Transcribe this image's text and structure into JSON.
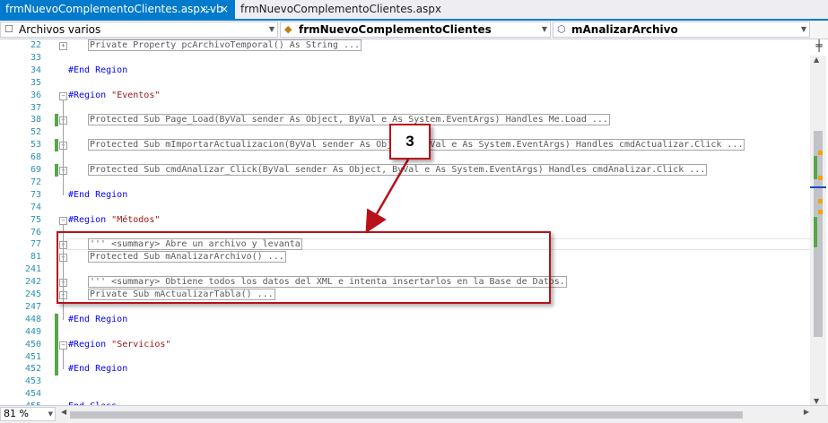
{
  "tabs": [
    {
      "label": "frmNuevoComplementoClientes.aspx.vb",
      "pin": "⊹",
      "close": "×"
    },
    {
      "label": "frmNuevoComplementoClientes.aspx"
    }
  ],
  "nav": {
    "project": "Archivos varios",
    "class": "frmNuevoComplementoClientes",
    "member": "mAnalizarArchivo"
  },
  "zoom": "81 %",
  "annotation": {
    "number": "3"
  },
  "lines": [
    {
      "n": "22",
      "fold": "+",
      "parts": [
        {
          "t": "Private Property pcArchivoTemporal() As String ..."
        }
      ],
      "collapsed": true,
      "indent": true
    },
    {
      "n": "33"
    },
    {
      "n": "34",
      "parts": [
        {
          "k": "#End Region"
        }
      ]
    },
    {
      "n": "35"
    },
    {
      "n": "36",
      "fold": "-",
      "parts": [
        {
          "k": "#Region "
        },
        {
          "s": "\"Eventos\""
        }
      ]
    },
    {
      "n": "37"
    },
    {
      "n": "38",
      "fold": "+",
      "chg": true,
      "parts": [
        {
          "t": "Protected Sub Page_Load(ByVal sender As Object, ByVal e As System.EventArgs) Handles Me.Load ..."
        }
      ],
      "collapsed": true,
      "indent": true
    },
    {
      "n": "52"
    },
    {
      "n": "53",
      "fold": "+",
      "chg": true,
      "parts": [
        {
          "t": "Protected Sub mImportarActualizacion(ByVal sender As Object, ByVal e As System.EventArgs) Handles cmdActualizar.Click ..."
        }
      ],
      "collapsed": true,
      "indent": true
    },
    {
      "n": "68"
    },
    {
      "n": "69",
      "fold": "+",
      "chg": true,
      "parts": [
        {
          "t": "Protected Sub cmdAnalizar_Click(ByVal sender As Object, ByVal e As System.EventArgs) Handles cmdAnalizar.Click ..."
        }
      ],
      "collapsed": true,
      "indent": true
    },
    {
      "n": "72"
    },
    {
      "n": "73",
      "parts": [
        {
          "k": "#End Region"
        }
      ]
    },
    {
      "n": "74"
    },
    {
      "n": "75",
      "fold": "-",
      "parts": [
        {
          "k": "#Region "
        },
        {
          "s": "\"Métodos\""
        }
      ]
    },
    {
      "n": "76"
    },
    {
      "n": "77",
      "fold": "+",
      "parts": [
        {
          "t": "''' <summary> Abre un archivo y levanta"
        }
      ],
      "collapsed": true,
      "indent": true
    },
    {
      "n": "81",
      "fold": "+",
      "parts": [
        {
          "t": "Protected Sub mAnalizarArchivo() ..."
        }
      ],
      "collapsed": true,
      "indent": true
    },
    {
      "n": "241"
    },
    {
      "n": "242",
      "fold": "+",
      "parts": [
        {
          "t": "''' <summary> Obtiene todos los datos del XML e intenta insertarlos en la Base de Datos."
        }
      ],
      "collapsed": true,
      "indent": true
    },
    {
      "n": "245",
      "fold": "+",
      "parts": [
        {
          "t": "Private Sub mActualizarTabla() ..."
        }
      ],
      "collapsed": true,
      "indent": true
    },
    {
      "n": "247"
    },
    {
      "n": "448",
      "chg": true,
      "parts": [
        {
          "k": "#End Region"
        }
      ]
    },
    {
      "n": "449",
      "chg": true
    },
    {
      "n": "450",
      "fold": "-",
      "chg": true,
      "parts": [
        {
          "k": "#Region "
        },
        {
          "s": "\"Servicios\""
        }
      ]
    },
    {
      "n": "451",
      "chg": true
    },
    {
      "n": "452",
      "chg": true,
      "parts": [
        {
          "k": "#End Region"
        }
      ]
    },
    {
      "n": "453"
    },
    {
      "n": "454"
    },
    {
      "n": "455",
      "parts": [
        {
          "k": "End Class"
        }
      ]
    }
  ]
}
